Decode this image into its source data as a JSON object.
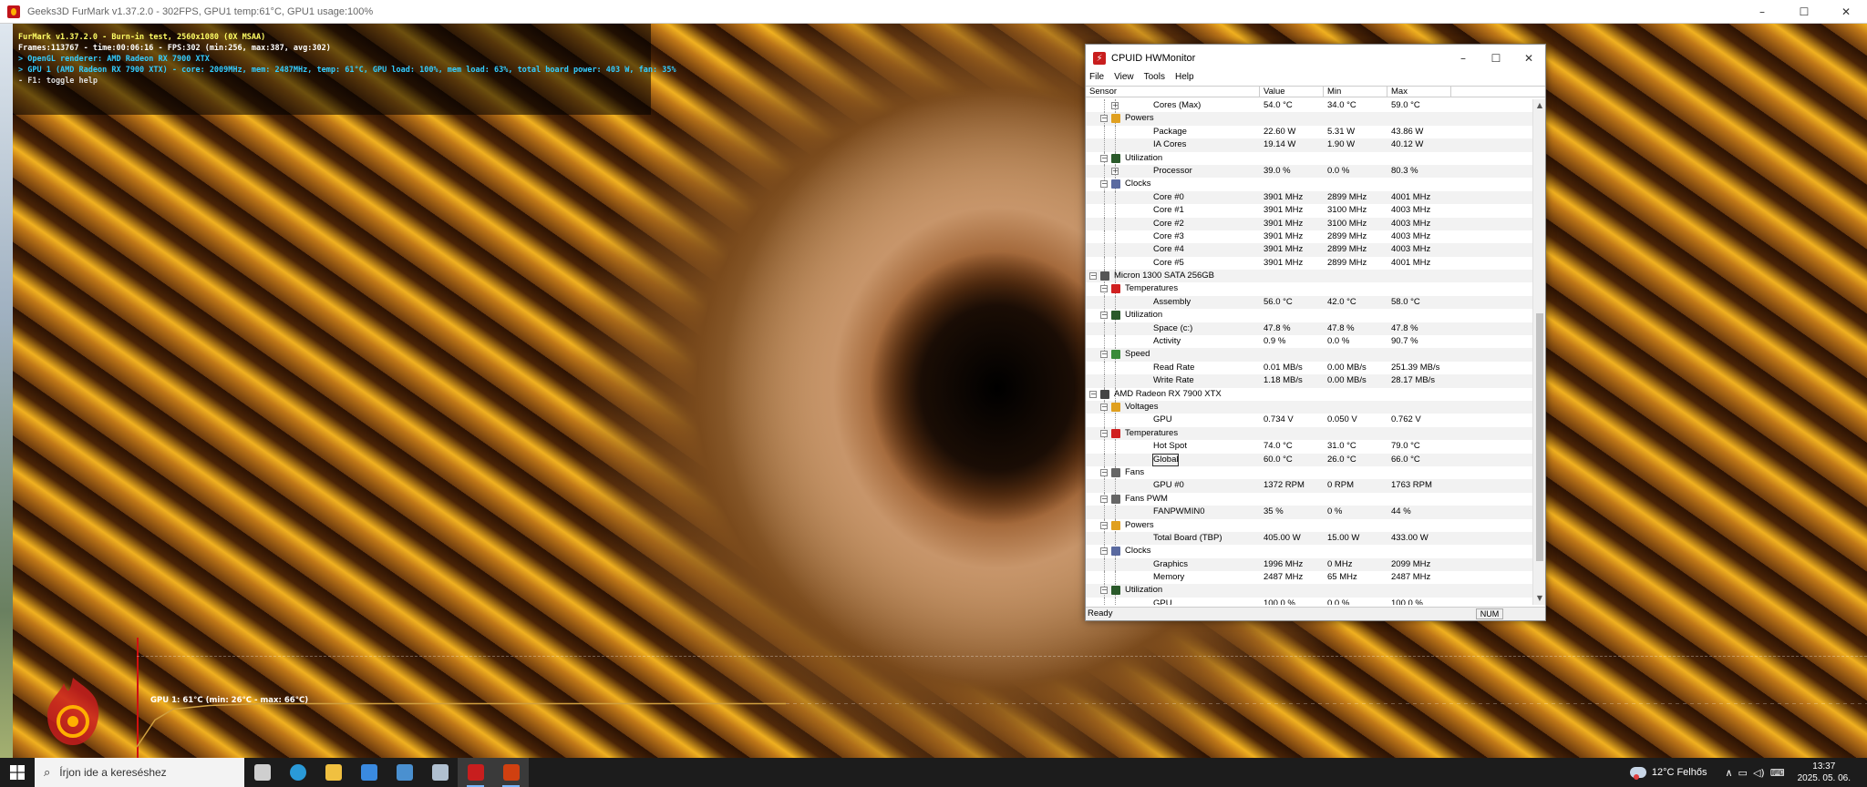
{
  "furmark": {
    "window_title": "Geeks3D FurMark v1.37.2.0 - 302FPS, GPU1 temp:61°C, GPU1 usage:100%",
    "hud": {
      "line1": "FurMark v1.37.2.0 - Burn-in test, 2560x1080 (0X MSAA)",
      "line2": "Frames:113767 - time:00:06:16 - FPS:302 (min:256, max:387, avg:302)",
      "line3": "> OpenGL renderer: AMD Radeon RX 7900 XTX",
      "line4": "> GPU 1 (AMD Radeon RX 7900 XTX) - core: 2009MHz, mem: 2487MHz, temp: 61°C, GPU load: 100%, mem load: 63%, total board power: 403 W, fan: 35%",
      "line5": "- F1: toggle help"
    },
    "graph_label": "GPU 1: 61°C (min: 26°C - max: 66°C)",
    "colors": {
      "hud_title": "#ffff66",
      "hud_text": "#ffffff",
      "hud_info": "#33ccff",
      "graph_line": "#d0a040"
    }
  },
  "hwmonitor": {
    "title": "CPUID HWMonitor",
    "menu": [
      "File",
      "View",
      "Tools",
      "Help"
    ],
    "columns": {
      "sensor": "Sensor",
      "value": "Value",
      "min": "Min",
      "max": "Max"
    },
    "rows": [
      {
        "label": "Cores (Max)",
        "value": "54.0 °C",
        "min": "34.0 °C",
        "max": "59.0 °C",
        "level": 3,
        "kind": "leaf-expand"
      },
      {
        "label": "Powers",
        "level": 2,
        "kind": "category",
        "icon": "power-icon"
      },
      {
        "label": "Package",
        "value": "22.60 W",
        "min": "5.31 W",
        "max": "43.86 W",
        "level": 3,
        "kind": "leaf"
      },
      {
        "label": "IA Cores",
        "value": "19.14 W",
        "min": "1.90 W",
        "max": "40.12 W",
        "level": 3,
        "kind": "leaf"
      },
      {
        "label": "Utilization",
        "level": 2,
        "kind": "category",
        "icon": "utilization-icon"
      },
      {
        "label": "Processor",
        "value": "39.0 %",
        "min": "0.0 %",
        "max": "80.3 %",
        "level": 3,
        "kind": "leaf-expand"
      },
      {
        "label": "Clocks",
        "level": 2,
        "kind": "category",
        "icon": "clock-icon"
      },
      {
        "label": "Core #0",
        "value": "3901 MHz",
        "min": "2899 MHz",
        "max": "4001 MHz",
        "level": 3,
        "kind": "leaf"
      },
      {
        "label": "Core #1",
        "value": "3901 MHz",
        "min": "3100 MHz",
        "max": "4003 MHz",
        "level": 3,
        "kind": "leaf"
      },
      {
        "label": "Core #2",
        "value": "3901 MHz",
        "min": "3100 MHz",
        "max": "4003 MHz",
        "level": 3,
        "kind": "leaf"
      },
      {
        "label": "Core #3",
        "value": "3901 MHz",
        "min": "2899 MHz",
        "max": "4003 MHz",
        "level": 3,
        "kind": "leaf"
      },
      {
        "label": "Core #4",
        "value": "3901 MHz",
        "min": "2899 MHz",
        "max": "4003 MHz",
        "level": 3,
        "kind": "leaf"
      },
      {
        "label": "Core #5",
        "value": "3901 MHz",
        "min": "2899 MHz",
        "max": "4001 MHz",
        "level": 3,
        "kind": "leaf"
      },
      {
        "label": "Micron 1300 SATA 256GB",
        "level": 1,
        "kind": "device",
        "icon": "drive-icon"
      },
      {
        "label": "Temperatures",
        "level": 2,
        "kind": "category",
        "icon": "temperature-icon"
      },
      {
        "label": "Assembly",
        "value": "56.0 °C",
        "min": "42.0 °C",
        "max": "58.0 °C",
        "level": 3,
        "kind": "leaf"
      },
      {
        "label": "Utilization",
        "level": 2,
        "kind": "category",
        "icon": "utilization-icon"
      },
      {
        "label": "Space (c:)",
        "value": "47.8 %",
        "min": "47.8 %",
        "max": "47.8 %",
        "level": 3,
        "kind": "leaf"
      },
      {
        "label": "Activity",
        "value": "0.9 %",
        "min": "0.0 %",
        "max": "90.7 %",
        "level": 3,
        "kind": "leaf"
      },
      {
        "label": "Speed",
        "level": 2,
        "kind": "category",
        "icon": "speed-icon"
      },
      {
        "label": "Read Rate",
        "value": "0.01 MB/s",
        "min": "0.00 MB/s",
        "max": "251.39 MB/s",
        "level": 3,
        "kind": "leaf"
      },
      {
        "label": "Write Rate",
        "value": "1.18 MB/s",
        "min": "0.00 MB/s",
        "max": "28.17 MB/s",
        "level": 3,
        "kind": "leaf"
      },
      {
        "label": "AMD Radeon RX 7900 XTX",
        "level": 1,
        "kind": "device",
        "icon": "gpu-icon"
      },
      {
        "label": "Voltages",
        "level": 2,
        "kind": "category",
        "icon": "voltage-icon"
      },
      {
        "label": "GPU",
        "value": "0.734 V",
        "min": "0.050 V",
        "max": "0.762 V",
        "level": 3,
        "kind": "leaf"
      },
      {
        "label": "Temperatures",
        "level": 2,
        "kind": "category",
        "icon": "temperature-icon"
      },
      {
        "label": "Hot Spot",
        "value": "74.0 °C",
        "min": "31.0 °C",
        "max": "79.0 °C",
        "level": 3,
        "kind": "leaf"
      },
      {
        "label": "Global",
        "value": "60.0 °C",
        "min": "26.0 °C",
        "max": "66.0 °C",
        "level": 3,
        "kind": "leaf",
        "selected": true
      },
      {
        "label": "Fans",
        "level": 2,
        "kind": "category",
        "icon": "fan-icon"
      },
      {
        "label": "GPU #0",
        "value": "1372 RPM",
        "min": "0 RPM",
        "max": "1763 RPM",
        "level": 3,
        "kind": "leaf"
      },
      {
        "label": "Fans PWM",
        "level": 2,
        "kind": "category",
        "icon": "fan-icon"
      },
      {
        "label": "FANPWMIN0",
        "value": "35 %",
        "min": "0 %",
        "max": "44 %",
        "level": 3,
        "kind": "leaf"
      },
      {
        "label": "Powers",
        "level": 2,
        "kind": "category",
        "icon": "power-icon"
      },
      {
        "label": "Total Board (TBP)",
        "value": "405.00 W",
        "min": "15.00 W",
        "max": "433.00 W",
        "level": 3,
        "kind": "leaf"
      },
      {
        "label": "Clocks",
        "level": 2,
        "kind": "category",
        "icon": "clock-icon"
      },
      {
        "label": "Graphics",
        "value": "1996 MHz",
        "min": "0 MHz",
        "max": "2099 MHz",
        "level": 3,
        "kind": "leaf"
      },
      {
        "label": "Memory",
        "value": "2487 MHz",
        "min": "65 MHz",
        "max": "2487 MHz",
        "level": 3,
        "kind": "leaf"
      },
      {
        "label": "Utilization",
        "level": 2,
        "kind": "category",
        "icon": "utilization-icon"
      },
      {
        "label": "GPU",
        "value": "100.0 %",
        "min": "0.0 %",
        "max": "100.0 %",
        "level": 3,
        "kind": "leaf"
      }
    ],
    "status": "Ready",
    "num_indicator": "NUM",
    "icon_colors": {
      "power-icon": "#e0a020",
      "utilization-icon": "#2a5a2a",
      "clock-icon": "#5a6aa0",
      "drive-icon": "#555555",
      "temperature-icon": "#d02020",
      "speed-icon": "#3a8a3a",
      "gpu-icon": "#444444",
      "voltage-icon": "#e0a020",
      "fan-icon": "#666666"
    }
  },
  "taskbar": {
    "search_placeholder": "Írjon ide a kereséshez",
    "apps": [
      {
        "name": "task-view-icon",
        "color": "#cfcfcf"
      },
      {
        "name": "edge-icon",
        "color": "#2a9ad8"
      },
      {
        "name": "file-explorer-icon",
        "color": "#f0c040"
      },
      {
        "name": "store-icon",
        "color": "#3a8ae0"
      },
      {
        "name": "mail-icon",
        "color": "#4a90d0"
      },
      {
        "name": "unknown-app-icon",
        "color": "#b0c0d0"
      },
      {
        "name": "hwmonitor-icon",
        "color": "#c81e1e",
        "active": true
      },
      {
        "name": "furmark-icon",
        "color": "#d04010",
        "active": true
      }
    ],
    "weather": "12°C  Felhős",
    "time": "13:37",
    "date": "2025. 05. 06."
  }
}
